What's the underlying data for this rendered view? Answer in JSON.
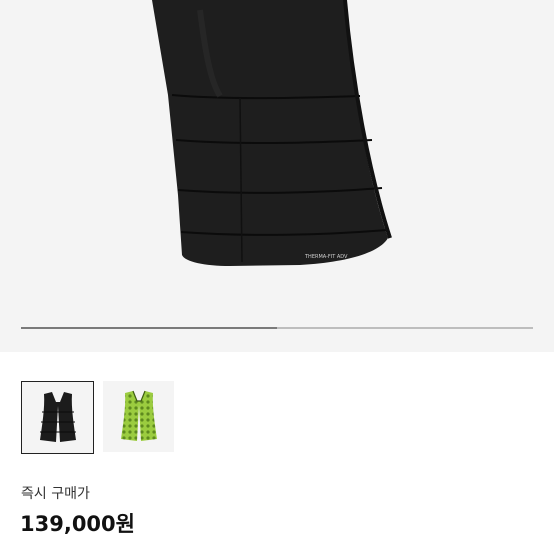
{
  "gallery": {
    "hero_image": "black-padded-vest-image",
    "hero_logo_text": "THERMA-FIT ADV",
    "slide_progress": 0.5,
    "thumbnails": [
      {
        "name": "black-vest-thumbnail",
        "selected": true,
        "color": "#1c1c1c"
      },
      {
        "name": "green-pattern-vest-thumbnail",
        "selected": false,
        "color": "#8fc23a"
      }
    ]
  },
  "purchase": {
    "label": "즉시 구매가",
    "price": "139,000원"
  }
}
